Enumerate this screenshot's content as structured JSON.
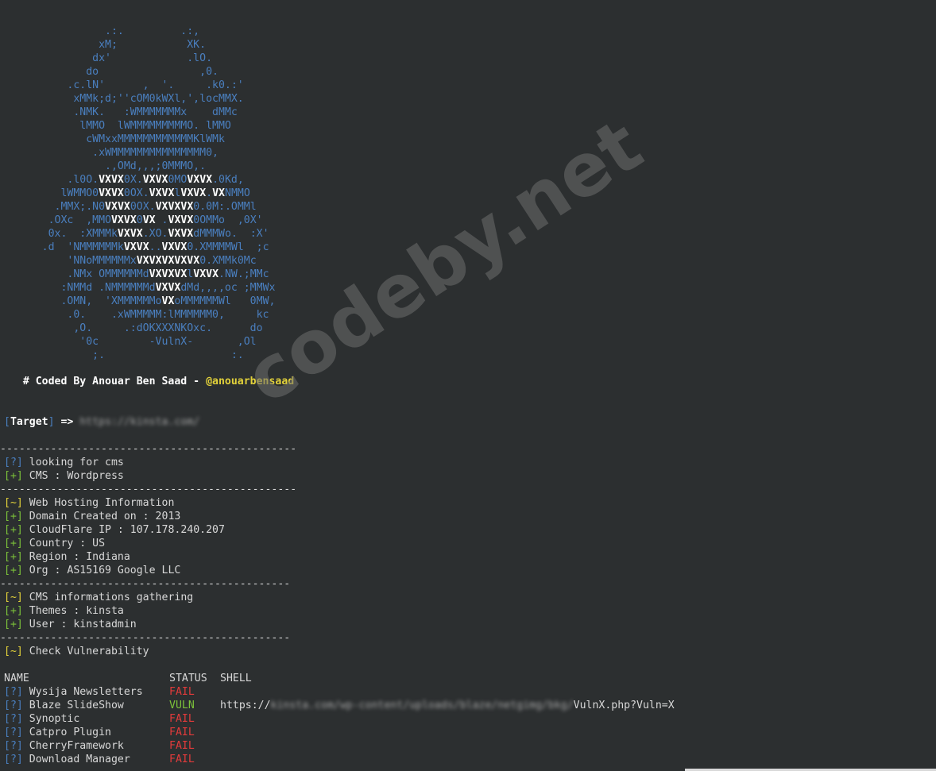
{
  "banner": {
    "art_lines": [
      "                .:.         .:,",
      "               xM;           XK.",
      "              dx'            .lO.",
      "             do                ,0.",
      "          .c.lN'      ,  '.     .k0.:'",
      "           xMMk;d;''cOM0kWXl,',locMMX.",
      "           .NMK.   :WMMMMMMMx    dMMc",
      "            lMMO  lWMMMMMMMMMO. lMMO",
      "             cWMxxMMMMMMMMMMMMKlWMk",
      "              .xWMMMMMMMMMMMMMMM0,",
      "                .,OMd,,,;0MMMO,.",
      "          .l0O.VXVX0X.VXVX0MOVXVX.0Kd,",
      "         lWMMO0VXVX0OX.VXVXlVXVX.VXNMMO",
      "        .MMX;.N0VXVX0OX.VXVXVX0.0M:.OMMl",
      "       .OXc  ,MMOVXVX0VX .VXVX0OMMo  ,0X'",
      "       0x.  :XMMMkVXVX.XO.VXVXdMMMWo.  :X'",
      "      .d  'NMMMMMMkVXVX..VXVX0.XMMMMWl  ;c",
      "          'NNoMMMMMMxVXVXVXVXVX0.XMMk0Mc",
      "          .NMx OMMMMMMdVXVXVXlVXVX.NW.;MMc",
      "         :NMMd .NMMMMMMdVXVXdMd,,,,oc ;MMWx",
      "         .OMN,  'XMMMMMMoVXoMMMMMMWl   0MW,",
      "          .0.    .xWMMMMM:lMMMMMM0,     kc",
      "           ,O.     .:dOKXXXNKOxc.      do",
      "            '0c        -VulnX-       ,Ol",
      "              ;.                    :."
    ],
    "credit_prefix": "   # Coded By Anouar Ben Saad - ",
    "credit_handle": "@anouarbensaad"
  },
  "target": {
    "open": "[",
    "label": "Target",
    "close": "]",
    "arrow": " => ",
    "url": "https://kinsta.com/"
  },
  "separator": "-----------------------------------------------",
  "separator_short": "----------------------------------------------",
  "sections": {
    "cms_lookup": [
      {
        "marker": "[?]",
        "color": "blue",
        "text": " looking for cms"
      },
      {
        "marker": "[+]",
        "color": "green",
        "text": " CMS : Wordpress"
      }
    ],
    "hosting": [
      {
        "marker": "[~]",
        "color": "yellow",
        "text": " Web Hosting Information"
      },
      {
        "marker": "[+]",
        "color": "green",
        "text": " Domain Created on : 2013"
      },
      {
        "marker": "[+]",
        "color": "green",
        "text": " CloudFlare IP : 107.178.240.207"
      },
      {
        "marker": "[+]",
        "color": "green",
        "text": " Country : US"
      },
      {
        "marker": "[+]",
        "color": "green",
        "text": " Region : Indiana"
      },
      {
        "marker": "[+]",
        "color": "green",
        "text": " Org : AS15169 Google LLC"
      }
    ],
    "cms_info": [
      {
        "marker": "[~]",
        "color": "yellow",
        "text": " CMS informations gathering"
      },
      {
        "marker": "[+]",
        "color": "green",
        "text": " Themes : kinsta"
      },
      {
        "marker": "[+]",
        "color": "green",
        "text": " User : kinstadmin"
      }
    ],
    "vuln_header": {
      "marker": "[~]",
      "color": "yellow",
      "text": " Check Vulnerability"
    }
  },
  "vuln_table": {
    "headers": {
      "name": "NAME",
      "status": "STATUS",
      "shell": "SHELL"
    },
    "rows": [
      {
        "marker": "[?]",
        "name": "Wysija Newsletters",
        "status": "FAIL",
        "shell_prefix": "",
        "shell_blurred": "",
        "shell_suffix": ""
      },
      {
        "marker": "[?]",
        "name": "Blaze SlideShow",
        "status": "VULN",
        "shell_prefix": "https://",
        "shell_blurred": "kinsta.com/wp-content/uploads/blaze/netgimg/bkg/",
        "shell_suffix": "VulnX.php?Vuln=X"
      },
      {
        "marker": "[?]",
        "name": "Synoptic",
        "status": "FAIL",
        "shell_prefix": "",
        "shell_blurred": "",
        "shell_suffix": ""
      },
      {
        "marker": "[?]",
        "name": "Catpro Plugin",
        "status": "FAIL",
        "shell_prefix": "",
        "shell_blurred": "",
        "shell_suffix": ""
      },
      {
        "marker": "[?]",
        "name": "CherryFramework",
        "status": "FAIL",
        "shell_prefix": "",
        "shell_blurred": "",
        "shell_suffix": ""
      },
      {
        "marker": "[?]",
        "name": "Download Manager",
        "status": "FAIL",
        "shell_prefix": "",
        "shell_blurred": "",
        "shell_suffix": ""
      }
    ]
  },
  "watermark": "codeby.net",
  "colors": {
    "background": "#2c2f30",
    "text": "#d8d8d8",
    "art_blue": "#4a7fbf",
    "marker_green": "#7cc23a",
    "marker_yellow": "#e3d23a",
    "fail_red": "#e23b3b",
    "vuln_green": "#7cc23a"
  }
}
